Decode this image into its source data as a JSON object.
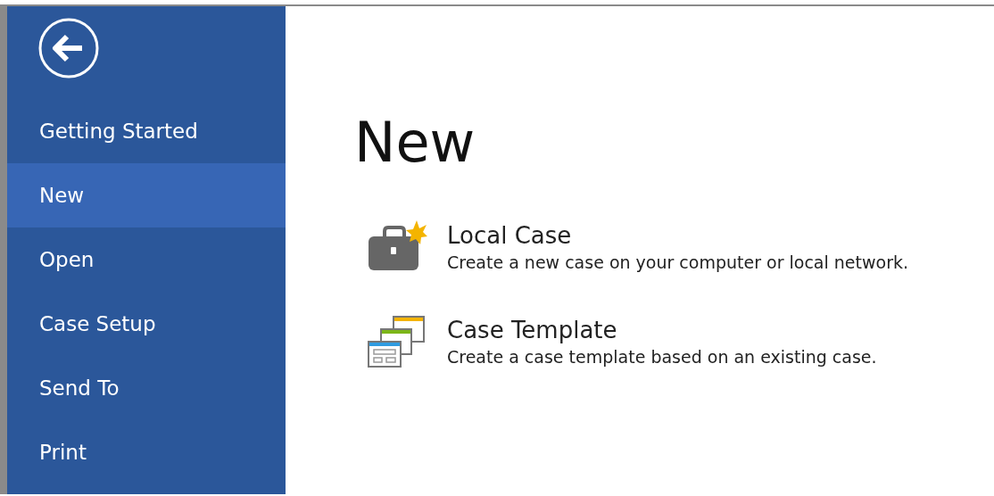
{
  "sidebar": {
    "items": [
      {
        "label": "Getting Started",
        "selected": false
      },
      {
        "label": "New",
        "selected": true
      },
      {
        "label": "Open",
        "selected": false
      },
      {
        "label": "Case Setup",
        "selected": false
      },
      {
        "label": "Send To",
        "selected": false
      },
      {
        "label": "Print",
        "selected": false
      }
    ]
  },
  "main": {
    "title": "New",
    "options": [
      {
        "kind": "local",
        "title": "Local Case",
        "description": "Create a new case on your computer or local network."
      },
      {
        "kind": "template",
        "title": "Case Template",
        "description": "Create a case template based on an existing case."
      }
    ]
  }
}
